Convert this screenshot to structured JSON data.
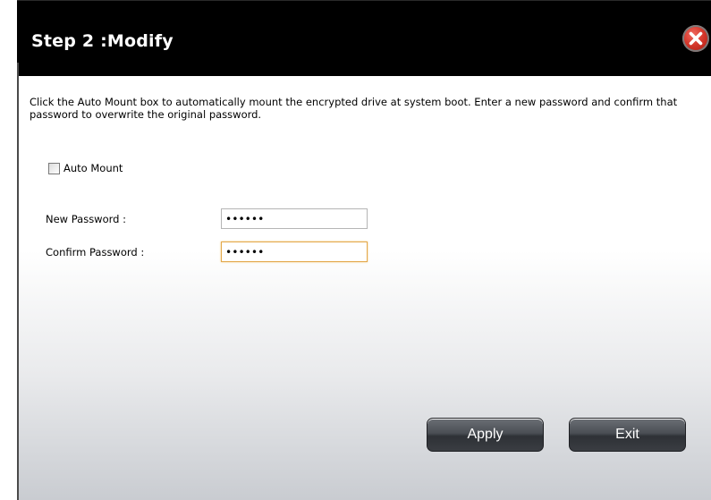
{
  "dialog": {
    "title": "Step 2 :Modify",
    "close_icon": "close-icon",
    "description": "Click the Auto Mount box to automatically mount the encrypted drive at system boot. Enter a new password and confirm that password to overwrite the original password.",
    "auto_mount": {
      "label": "Auto Mount",
      "checked": false
    },
    "new_password": {
      "label": "New Password :",
      "value": "••••••"
    },
    "confirm_password": {
      "label": "Confirm Password :",
      "value": "••••••"
    },
    "buttons": {
      "apply": "Apply",
      "exit": "Exit"
    }
  },
  "colors": {
    "titlebar": "#000000",
    "close_button": "#d3362a",
    "focus_border": "#e3a84a",
    "button_dark": "#3a3d42"
  }
}
